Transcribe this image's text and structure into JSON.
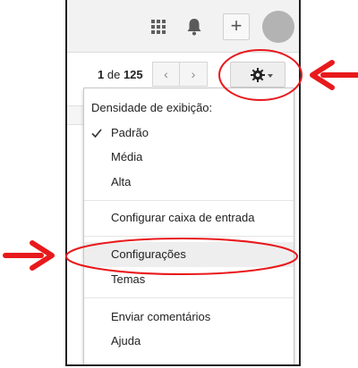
{
  "pagination": {
    "range": "1",
    "of": "de",
    "total": "125"
  },
  "nav": {
    "prev": "‹",
    "next": "›"
  },
  "topbar": {
    "plus": "+"
  },
  "menu": {
    "density_heading": "Densidade de exibição:",
    "density_options": [
      "Padrão",
      "Média",
      "Alta"
    ],
    "selected_density": "Padrão",
    "configure_inbox": "Configurar caixa de entrada",
    "settings": "Configurações",
    "themes": "Temas",
    "send_feedback": "Enviar comentários",
    "help": "Ajuda"
  },
  "annotation_color": "#e8191c",
  "icons": [
    "apps-grid-icon",
    "bell-icon",
    "plus-icon",
    "gear-icon",
    "chevron-left-icon",
    "chevron-right-icon",
    "checkmark-icon"
  ]
}
